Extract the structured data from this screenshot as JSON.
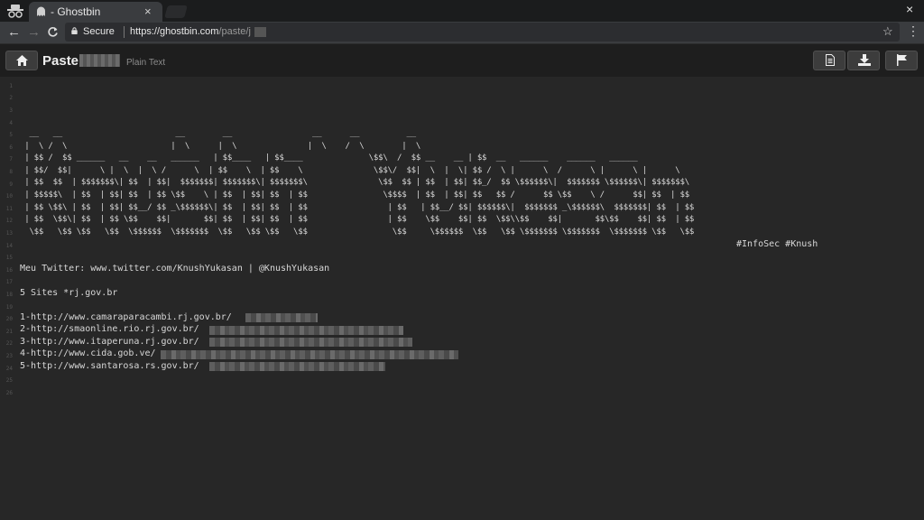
{
  "tab": {
    "title": "- Ghostbin",
    "close": "×"
  },
  "window": {
    "close": "×"
  },
  "toolbar": {
    "back": "←",
    "forward": "→",
    "reload": "C",
    "secure_label": "Secure",
    "url_host": "https://ghostbin.com",
    "url_path": "/paste/j",
    "star": "☆",
    "menu": "⋮"
  },
  "header": {
    "title": "Paste",
    "language": "Plain Text"
  },
  "line_numbers": [
    "1",
    "2",
    "3",
    "4",
    "5",
    "6",
    "7",
    "8",
    "9",
    "10",
    "11",
    "12",
    "13",
    "14",
    "15",
    "16",
    "17",
    "18",
    "19",
    "20",
    "21",
    "22",
    "23",
    "24",
    "25",
    "26"
  ],
  "paste": {
    "ascii_art": "  __   __                        __        __                 __      __          __\n |  \\ /  \\                      |  \\      |  \\               |  \\    /  \\        |  \\\n | $$ /  $$ ______   __    __   ______   | $$____   | $$____              \\$$\\  /  $$ __    __ | $$  __   ______    ______   ______\n | $$/  $$|      \\ |  \\  |  \\ /      \\  | $$    \\  | $$    \\               \\$$\\/  $$|  \\  |  \\| $$ /  \\ |      \\  /      \\ |      \\ |      \\\n | $$  $$  | $$$$$$$\\| $$  | $$|  $$$$$$$| $$$$$$$\\| $$$$$$$\\               \\$$  $$ | $$  | $$| $$_/  $$ \\$$$$$$\\|  $$$$$$$ \\$$$$$$\\| $$$$$$$\\\n | $$$$$\\  | $$  | $$| $$  | $$ \\$$    \\ | $$  | $$| $$  | $$                \\$$$$  | $$  | $$| $$   $$ /      $$ \\$$    \\ /      $$| $$  | $$\n | $$ \\$$\\ | $$  | $$| $$__/ $$ _\\$$$$$$\\| $$  | $$| $$  | $$                 | $$   | $$__/ $$| $$$$$$\\|  $$$$$$$ _\\$$$$$$\\  $$$$$$$| $$  | $$\n | $$  \\$$\\| $$  | $$ \\$$    $$|       $$| $$  | $$| $$  | $$                 | $$    \\$$    $$| $$  \\$$\\\\$$    $$|       $$\\$$    $$| $$  | $$\n  \\$$   \\$$ \\$$   \\$$  \\$$$$$$  \\$$$$$$$  \\$$   \\$$ \\$$   \\$$                  \\$$     \\$$$$$$  \\$$   \\$$ \\$$$$$$$ \\$$$$$$$  \\$$$$$$$ \\$$   \\$$",
    "tagline": "#InfoSec #Knush",
    "twitter": "Meu Twitter: www.twitter.com/KnushYukasan | @KnushYukasan",
    "sites_header": "5 Sites *rj.gov.br",
    "sites": [
      "1-http://www.camaraparacambi.rj.gov.br/",
      "2-http://smaonline.rio.rj.gov.br/",
      "3-http://www.itaperuna.rj.gov.br/",
      "4-http://www.cida.gob.ve/",
      "5-http://www.santarosa.rs.gov.br/"
    ]
  },
  "icons": {
    "home": "home-icon",
    "raw": "document-icon",
    "download": "download-icon",
    "report": "flag-icon",
    "incognito": "incognito-icon",
    "lock": "lock-icon"
  },
  "colors": {
    "background": "#272727",
    "text": "#d8d8d8",
    "line_number": "#555555",
    "chrome": "#3a3c3f"
  }
}
